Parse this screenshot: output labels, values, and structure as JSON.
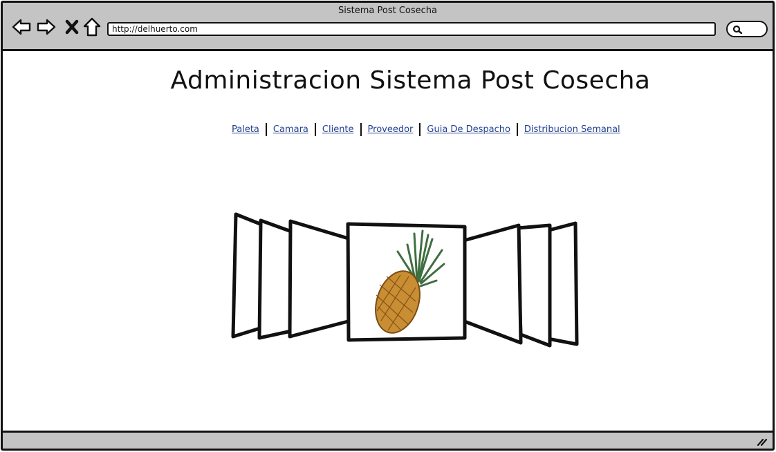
{
  "window": {
    "title": "Sistema Post Cosecha",
    "url": "http://delhuerto.com"
  },
  "toolbar": {
    "back_icon": "arrow-left-icon",
    "forward_icon": "arrow-right-icon",
    "stop_icon": "close-icon",
    "home_icon": "home-icon",
    "search_icon": "search-icon"
  },
  "page": {
    "title": "Administracion Sistema Post Cosecha",
    "nav": [
      {
        "label": "Paleta"
      },
      {
        "label": "Camara"
      },
      {
        "label": "Cliente"
      },
      {
        "label": "Proveedor"
      },
      {
        "label": "Guia De Despacho"
      },
      {
        "label": "Distribucion Semanal"
      }
    ]
  },
  "carousel": {
    "center_image": "pineapple-image",
    "link_color": "#1f3f8f"
  }
}
